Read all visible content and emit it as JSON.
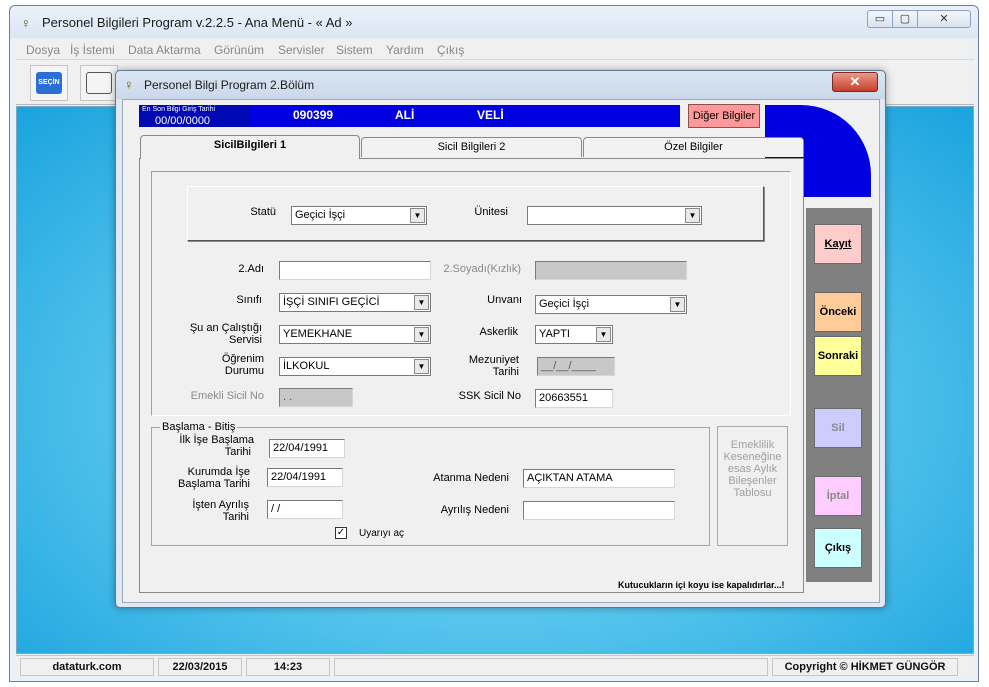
{
  "window": {
    "title": "Personel Bilgileri Program v.2.2.5  - Ana Menü -  « Ad »",
    "controls": {
      "minimize": "▭",
      "maximize": "▢",
      "close": "✕"
    }
  },
  "menu": [
    "Dosya",
    "İş İstemi",
    "Data Aktarma",
    "Görünüm",
    "Servisler",
    "Sistem",
    "Yardım",
    "Çıkış"
  ],
  "toolbar": {
    "first_button": "SEÇİN",
    "icons": [
      "select-icon",
      "edit-pen-icon",
      "document-icon",
      "folder-icon",
      "arrow-icon",
      "bell-icon",
      "tools-icon",
      "lock-icon",
      "book-icon",
      "info-icon",
      "exit-icon"
    ]
  },
  "status": {
    "site": "dataturk.com",
    "date": "22/03/2015",
    "time": "14:23",
    "copyright": "Copyright © HİKMET GÜNGÖR"
  },
  "dialog": {
    "title": "Personel Bilgi Program 2.Bölüm",
    "close": "✕",
    "header": {
      "last_entry_label": "En Son Bilgi Giriş Tarihi",
      "last_entry_date": "00/00/0000",
      "sicil": "090399",
      "name": "ALİ",
      "surname": "VELİ",
      "other_info_button": "Diğer Bilgiler"
    },
    "tabs": [
      "SicilBilgileri 1",
      "Sicil Bilgileri 2",
      "Özel Bilgiler"
    ],
    "form": {
      "statu_label": "Statü",
      "statu_value": "Geçici İşçi",
      "unite_label": "Ünitesi",
      "unite_value": "",
      "ad2_label": "2.Adı",
      "ad2_value": "",
      "soyad2_label": "2.Soyadı(Kızlık)",
      "soyad2_value": "",
      "sinif_label": "Sınıfı",
      "sinif_value": "İŞÇİ SINIFI GEÇİCİ",
      "unvan_label": "Unvanı",
      "unvan_value": "Geçici İşçi",
      "servis_label_1": "Şu an Çalıştığı",
      "servis_label_2": "Servisi",
      "servis_value": "YEMEKHANE",
      "askerlik_label": "Askerlik",
      "askerlik_value": "YAPTI",
      "ogrenim_label_1": "Öğrenim",
      "ogrenim_label_2": "Durumu",
      "ogrenim_value": "İLKOKUL",
      "mezuniyet_label_1": "Mezuniyet",
      "mezuniyet_label_2": "Tarihi",
      "mezuniyet_value": "__/__/____",
      "emekli_label": "Emekli Sicil No",
      "emekli_value": ". .",
      "ssk_label": "SSK Sicil No",
      "ssk_value": "20663551"
    },
    "dates": {
      "group_title": "Başlama - Bitiş",
      "ilk_label_1": "İlk İşe Başlama",
      "ilk_label_2": "Tarihi",
      "ilk_value": "22/04/1991",
      "kurum_label_1": "Kurumda İşe",
      "kurum_label_2": "Başlama Tarihi",
      "kurum_value": "22/04/1991",
      "ayrilis_label_1": "İşten Ayrılış",
      "ayrilis_label_2": "Tarihi",
      "ayrilis_value": " /  /",
      "atanma_label": "Atanma Nedeni",
      "atanma_value": "AÇIKTAN ATAMA",
      "ayrilis_neden_label": "Ayrılış Nedeni",
      "ayrilis_neden_value": "",
      "uyari_label": "Uyarıyı aç",
      "uyari_checked": "✓"
    },
    "emeklilik_box": [
      "Emeklilik",
      "Keseneğine",
      "esas Aylık",
      "Bileşenler",
      "Tablosu"
    ],
    "footnote": "Kutucukların içi koyu ise kapalıdırlar...!",
    "side_buttons": {
      "kayit": "Kayıt",
      "onceki": "Önceki",
      "sonraki": "Sonraki",
      "sil": "Sil",
      "iptal": "İptal",
      "cikis": "Çıkış"
    },
    "colors": {
      "kayit": "#ffcccc",
      "onceki": "#ffcc99",
      "sonraki": "#ffff99",
      "sil": "#ccccff",
      "iptal": "#ffccff",
      "cikis": "#ccffff"
    }
  }
}
